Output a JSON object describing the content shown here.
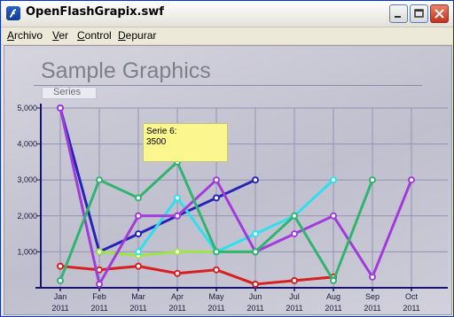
{
  "window": {
    "title": "OpenFlashGrapix.swf"
  },
  "menu": {
    "items": [
      {
        "accel": "A",
        "rest": "rchivo"
      },
      {
        "accel": "V",
        "rest": "er"
      },
      {
        "accel": "C",
        "rest": "ontrol"
      },
      {
        "accel": "D",
        "rest": "epurar"
      }
    ]
  },
  "chart": {
    "title": "Sample Graphics",
    "subtitle": "Series",
    "tooltip": {
      "line1": "Serie 6:",
      "line2": "3500"
    }
  },
  "chart_data": {
    "type": "line",
    "title": "Sample Graphics",
    "subtitle": "Series",
    "categories": [
      "Jan",
      "Feb",
      "Mar",
      "Apr",
      "May",
      "Jun",
      "Jul",
      "Aug",
      "Sep",
      "Oct"
    ],
    "category_years": [
      "2011",
      "2011",
      "2011",
      "2011",
      "2011",
      "2011",
      "2011",
      "2011",
      "2011",
      "2011"
    ],
    "ylim": [
      0,
      5000
    ],
    "yticks": [
      1000,
      2000,
      3000,
      4000,
      5000
    ],
    "ytick_labels": [
      "1,000",
      "2,000",
      "3,000",
      "4,000",
      "5,000"
    ],
    "grid": true,
    "series": [
      {
        "color": "#2424b8",
        "values": [
          5000,
          1000,
          1500,
          2000,
          2500,
          3000,
          null,
          null,
          null,
          null
        ]
      },
      {
        "color": "#d82020",
        "values": [
          600,
          500,
          600,
          400,
          500,
          100,
          200,
          300,
          null,
          null
        ]
      },
      {
        "color": "#9fe34a",
        "values": [
          null,
          1000,
          900,
          1000,
          1000,
          1000,
          null,
          null,
          null,
          null
        ]
      },
      {
        "color": "#2ee0ec",
        "values": [
          null,
          null,
          1000,
          2500,
          1000,
          1500,
          2000,
          3000,
          null,
          null
        ]
      },
      {
        "color": "#a23bdc",
        "values": [
          5000,
          100,
          2000,
          2000,
          3000,
          1000,
          1500,
          2000,
          300,
          3000
        ]
      },
      {
        "color": "#30b470",
        "values": [
          200,
          3000,
          2500,
          3500,
          1000,
          1000,
          2000,
          200,
          3000,
          null
        ]
      }
    ]
  }
}
